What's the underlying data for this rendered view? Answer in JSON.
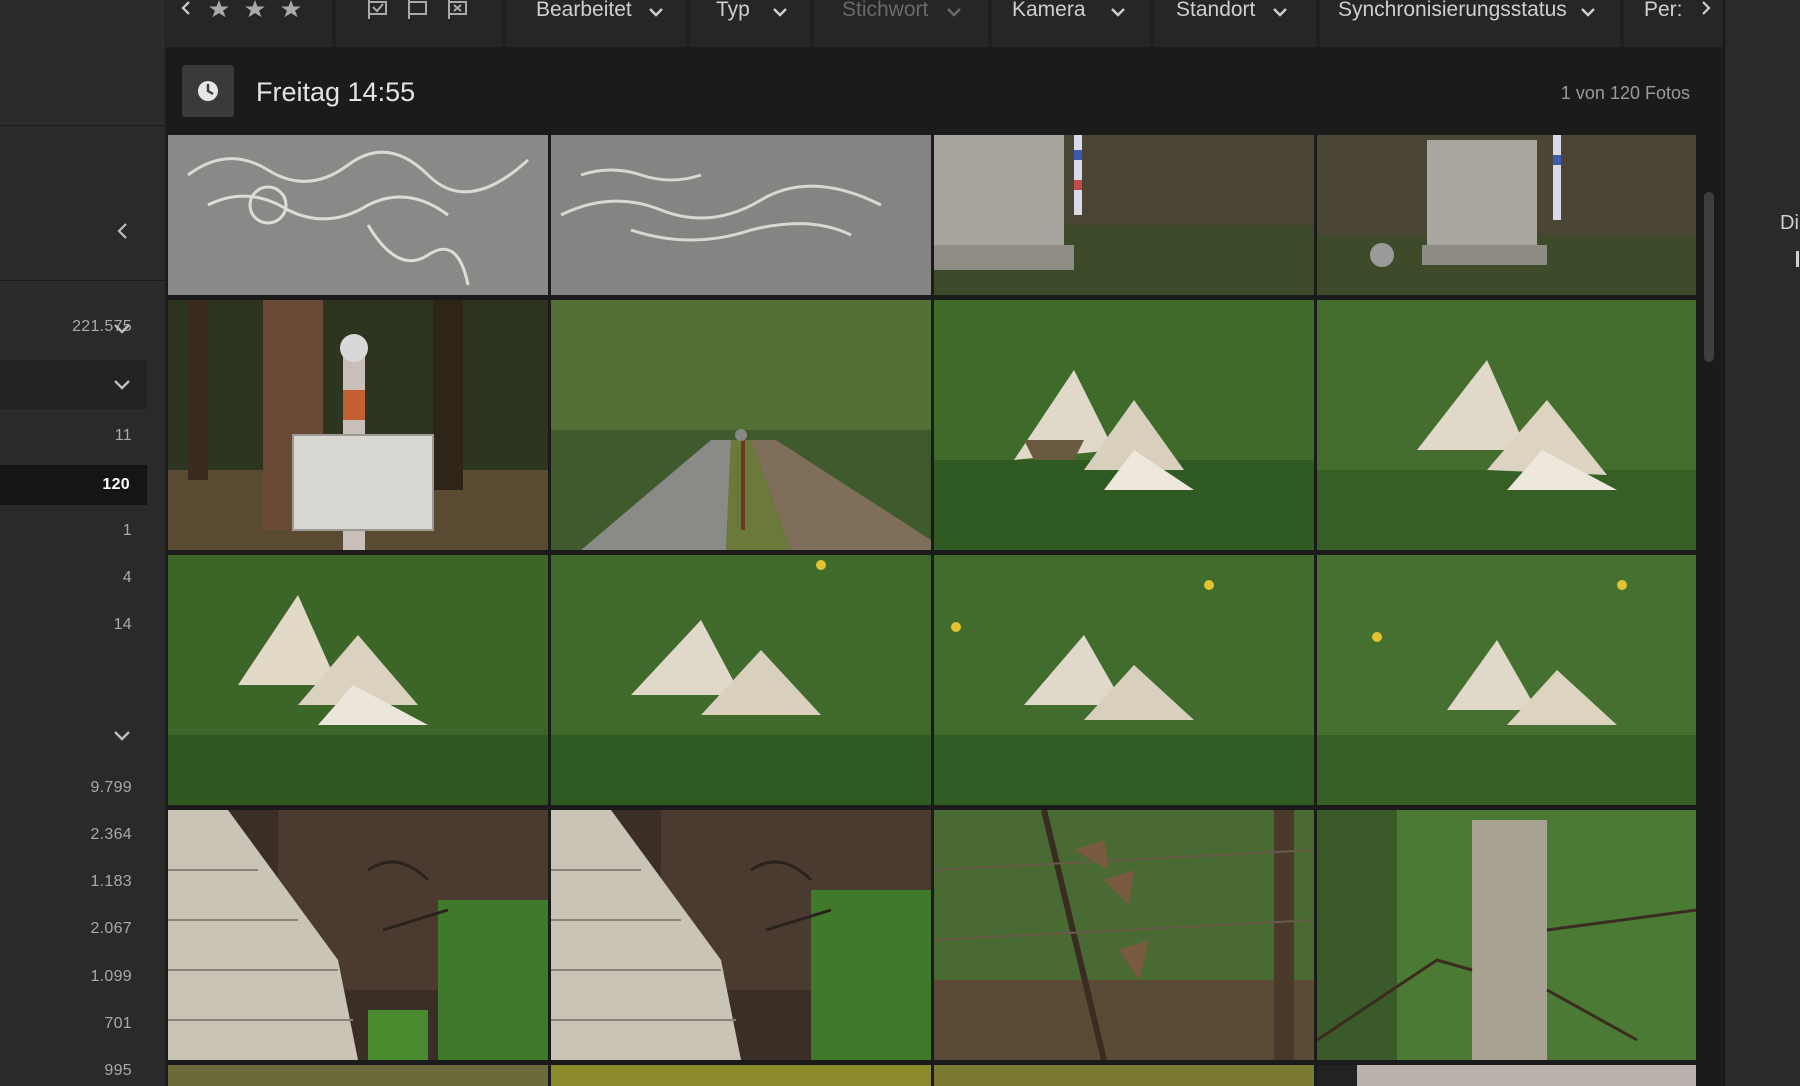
{
  "filterbar": {
    "items": [
      {
        "label": "Bearbeitet"
      },
      {
        "label": "Typ"
      },
      {
        "label": "Stichwort"
      },
      {
        "label": "Kamera"
      },
      {
        "label": "Standort"
      },
      {
        "label": "Synchronisierungsstatus"
      },
      {
        "label": "Per:"
      }
    ]
  },
  "header": {
    "title": "Freitag 14:55",
    "count": "1 von 120 Fotos"
  },
  "sidebar": {
    "counts": [
      "221.575",
      "11",
      "120",
      "1",
      "4",
      "14",
      "9.799",
      "2.364",
      "1.183",
      "2.067",
      "1.099",
      "701",
      "995"
    ]
  },
  "rightpanel": {
    "text": "Di"
  },
  "colors": {
    "background": "#1b1b1b",
    "panel": "#2a2a2a",
    "selected_row": "#151515"
  },
  "icons": [
    "chevron-left-icon",
    "star-icon",
    "flag-pick-icon",
    "flag-icon",
    "flag-reject-icon",
    "chevron-down-icon",
    "clock-icon",
    "chevron-right-icon"
  ]
}
